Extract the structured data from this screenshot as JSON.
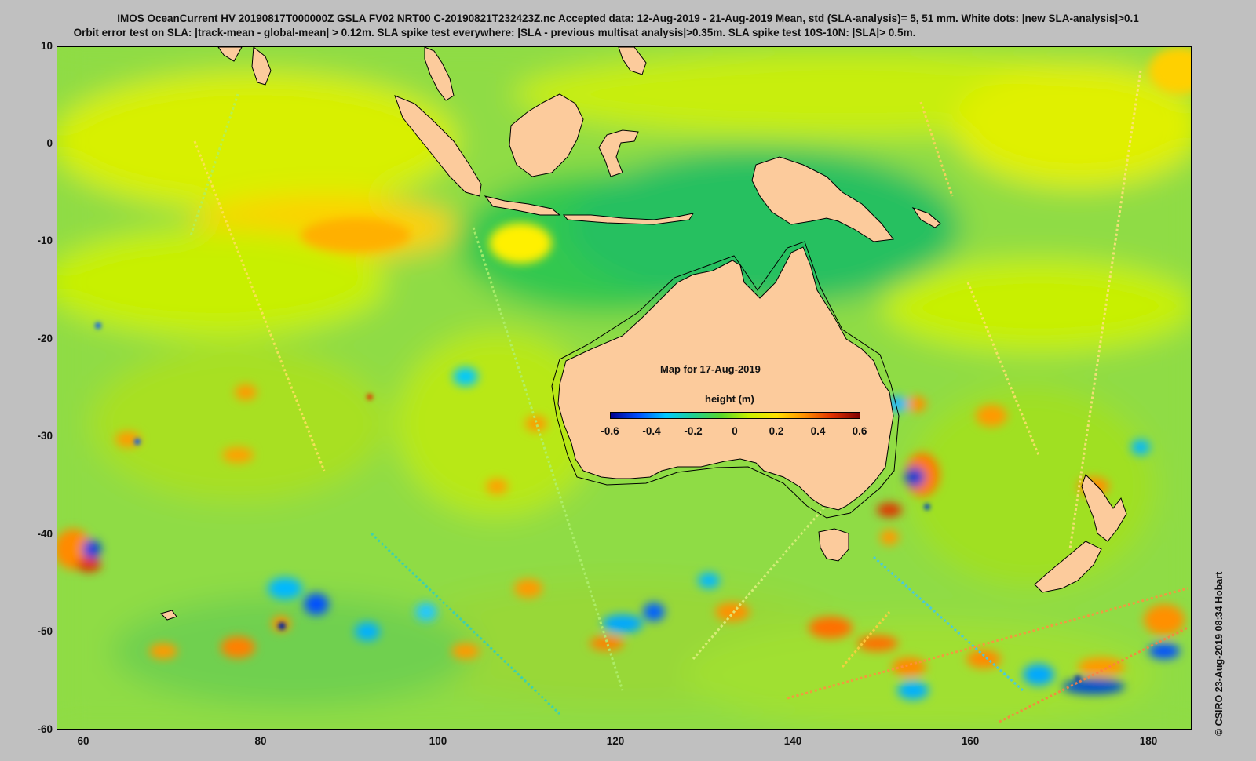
{
  "header": {
    "line1": "IMOS OceanCurrent HV 20190817T000000Z GSLA FV02 NRT00 C-20190821T232423Z.nc  Accepted data: 12-Aug-2019 - 21-Aug-2019 Mean, std (SLA-analysis)= 5, 51 mm. White dots: |new SLA-analysis|>0.1",
    "line2": "Orbit error test on SLA: |track-mean  - global-mean| > 0.12m.  SLA spike test everywhere: |SLA - previous multisat analysis|>0.35m. SLA spike test 10S-10N: |SLA|> 0.5m."
  },
  "map": {
    "date_label": "Map for 17-Aug-2019",
    "lon_range": [
      57,
      185
    ],
    "lat_range": [
      -60,
      10
    ],
    "ocean_base_color": "#8fdc45",
    "land_color": "#fccb9c",
    "x_ticks": [
      "60",
      "80",
      "100",
      "120",
      "140",
      "160",
      "180"
    ],
    "y_ticks": [
      "10",
      "0",
      "-10",
      "-20",
      "-30",
      "-40",
      "-50",
      "-60"
    ]
  },
  "legend": {
    "title": "height (m)",
    "ticks": [
      "-0.6",
      "-0.4",
      "-0.2",
      "0",
      "0.2",
      "0.4",
      "0.6"
    ],
    "colors": [
      "#00008f",
      "#0050ff",
      "#00c8ff",
      "#20d090",
      "#5ad62a",
      "#c8f000",
      "#ffe000",
      "#ff9000",
      "#e03000",
      "#800000"
    ]
  },
  "footer": {
    "copyright": "© CSIRO 23-Aug-2019 08:34 Hobart"
  }
}
